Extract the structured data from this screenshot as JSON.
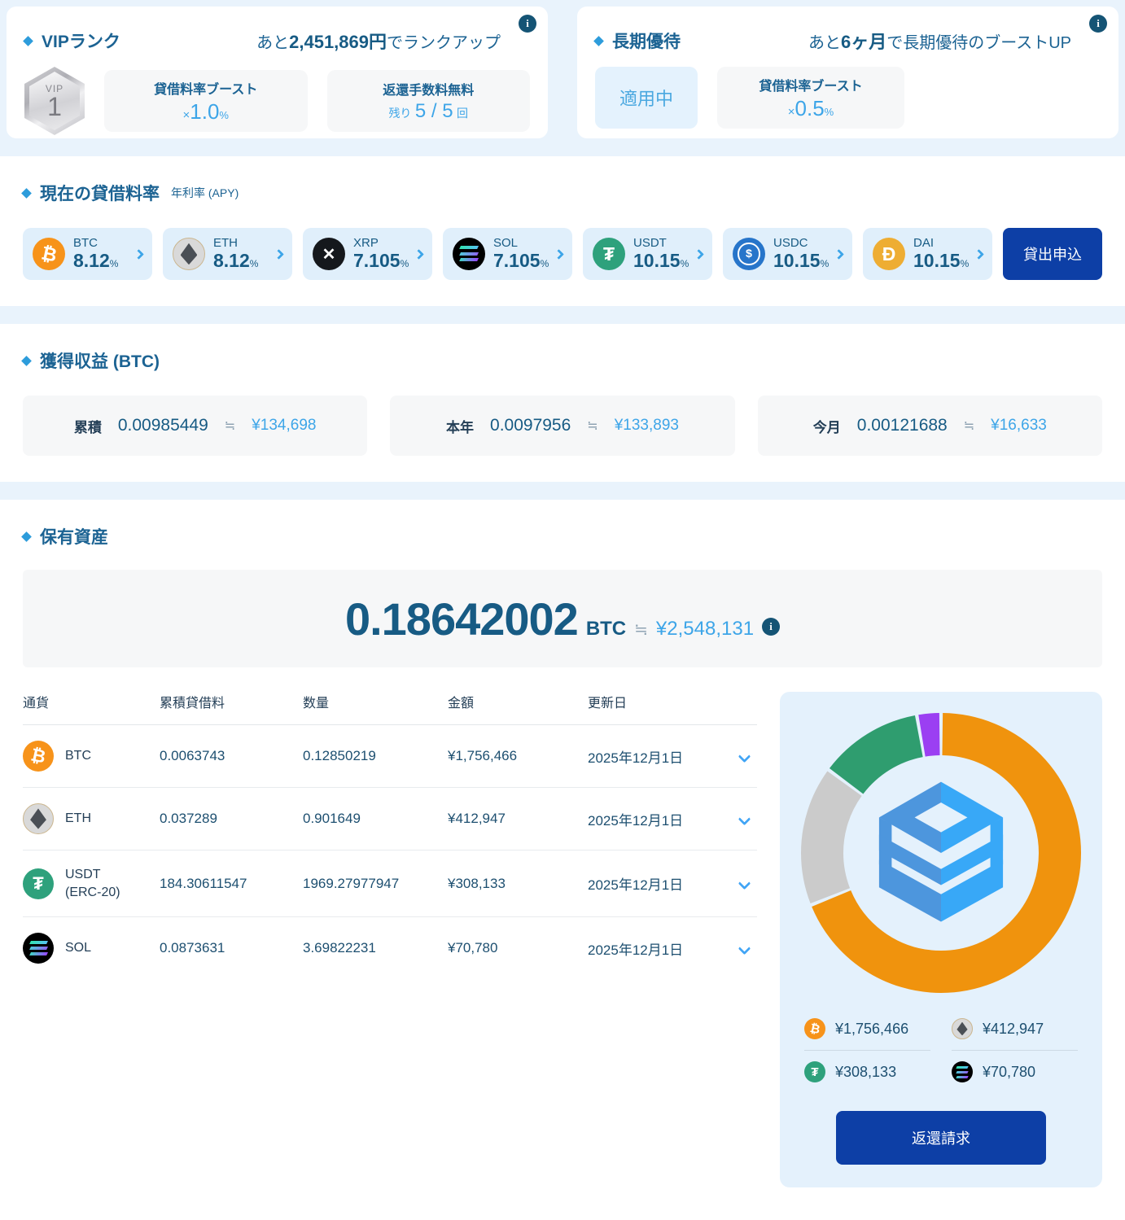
{
  "vip_card": {
    "title": "VIPランク",
    "note_prefix": "あと",
    "note_strong": "2,451,869円",
    "note_suffix": "でランクアップ",
    "badge": {
      "label": "VIP",
      "level": "1"
    },
    "boost": {
      "label": "貸借料率ブースト",
      "times": "×",
      "value": "1.0",
      "unit": "%"
    },
    "fee": {
      "label": "返還手数料無料",
      "remain_prefix": "残り",
      "remain_value": "5 / 5",
      "remain_unit": "回"
    },
    "info_icon": "i"
  },
  "longterm_card": {
    "title": "長期優待",
    "note_prefix": "あと",
    "note_strong": "6ヶ月",
    "note_suffix": "で長期優待のブーストUP",
    "status": "適用中",
    "boost": {
      "label": "貸借料率ブースト",
      "times": "×",
      "value": "0.5",
      "unit": "%"
    },
    "info_icon": "i"
  },
  "rates_section": {
    "title": "現在の貸借料率",
    "subtitle": "年利率 (APY)",
    "percent_sign": "%",
    "apply_button": "貸出申込",
    "rates": [
      {
        "symbol": "BTC",
        "rate": "8.12"
      },
      {
        "symbol": "ETH",
        "rate": "8.12"
      },
      {
        "symbol": "XRP",
        "rate": "7.105"
      },
      {
        "symbol": "SOL",
        "rate": "7.105"
      },
      {
        "symbol": "USDT",
        "rate": "10.15"
      },
      {
        "symbol": "USDC",
        "rate": "10.15"
      },
      {
        "symbol": "DAI",
        "rate": "10.15"
      }
    ]
  },
  "earnings_section": {
    "title": "獲得収益 (BTC)",
    "items": [
      {
        "label": "累積",
        "btc": "0.00985449",
        "approx": "≒",
        "jpy": "¥134,698"
      },
      {
        "label": "本年",
        "btc": "0.0097956",
        "approx": "≒",
        "jpy": "¥133,893"
      },
      {
        "label": "今月",
        "btc": "0.00121688",
        "approx": "≒",
        "jpy": "¥16,633"
      }
    ]
  },
  "assets_section": {
    "title": "保有資産",
    "total": {
      "btc": "0.18642002",
      "unit": "BTC",
      "approx": "≒",
      "jpy": "¥2,548,131",
      "info_icon": "i"
    },
    "table": {
      "headers": [
        "通貨",
        "累積貸借料",
        "数量",
        "金額",
        "更新日"
      ],
      "rows": [
        {
          "symbol": "BTC",
          "sub": "",
          "fee": "0.0063743",
          "qty": "0.12850219",
          "jpy": "¥1,756,466",
          "date": "2025年12月1日"
        },
        {
          "symbol": "ETH",
          "sub": "",
          "fee": "0.037289",
          "qty": "0.901649",
          "jpy": "¥412,947",
          "date": "2025年12月1日"
        },
        {
          "symbol": "USDT",
          "sub": "(ERC-20)",
          "fee": "184.30611547",
          "qty": "1969.27977947",
          "jpy": "¥308,133",
          "date": "2025年12月1日"
        },
        {
          "symbol": "SOL",
          "sub": "",
          "fee": "0.0873631",
          "qty": "3.69822231",
          "jpy": "¥70,780",
          "date": "2025年12月1日"
        }
      ]
    },
    "legend": [
      {
        "symbol": "BTC",
        "jpy": "¥1,756,466"
      },
      {
        "symbol": "ETH",
        "jpy": "¥412,947"
      },
      {
        "symbol": "USDT",
        "jpy": "¥308,133"
      },
      {
        "symbol": "SOL",
        "jpy": "¥70,780"
      }
    ],
    "return_button": "返還請求"
  },
  "icons": {
    "btc_glyph": "₿",
    "xrp_glyph": "✕",
    "usdt_glyph": "₮",
    "usdc_glyph": "$",
    "dai_glyph": "Ð"
  },
  "chart_data": {
    "type": "pie",
    "donut": true,
    "labels": [
      "BTC",
      "ETH",
      "USDT",
      "SOL"
    ],
    "values": [
      1756466,
      412947,
      308133,
      70780
    ],
    "unit": "JPY",
    "percentages": [
      68.93,
      16.2,
      12.09,
      2.78
    ],
    "colors": [
      "#f0930d",
      "#cbcbcb",
      "#2f9d6f",
      "#9b3ff2"
    ],
    "legend_position": "bottom"
  }
}
